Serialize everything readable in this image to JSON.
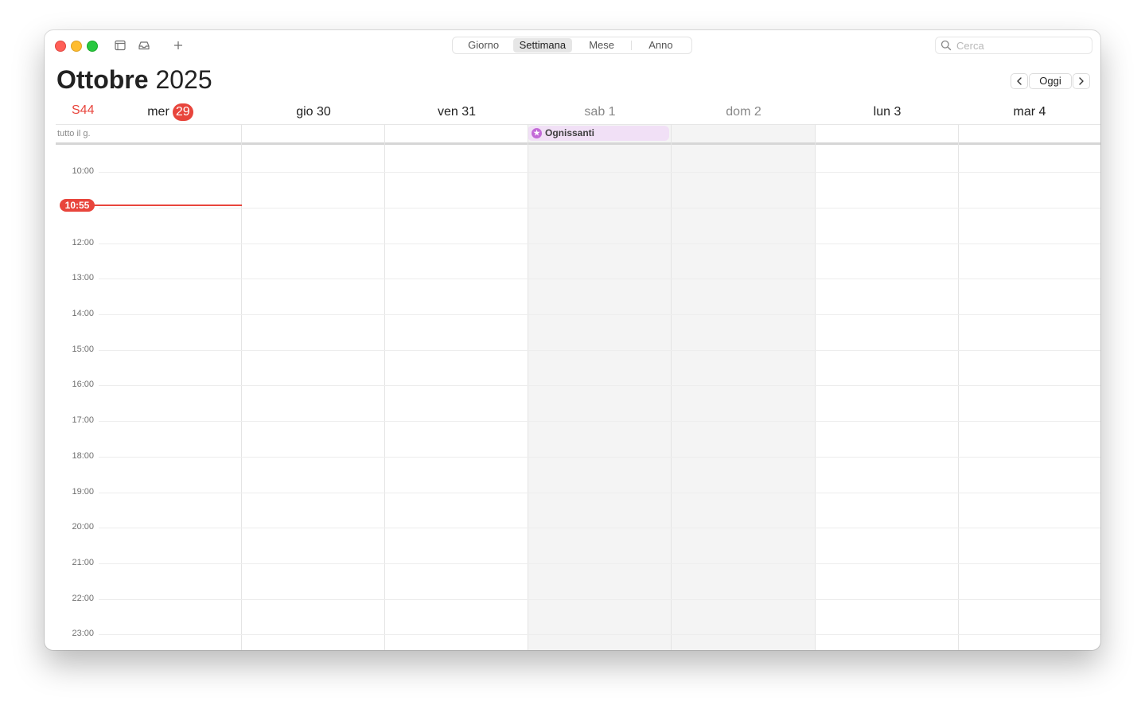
{
  "toolbar": {
    "views": [
      "Giorno",
      "Settimana",
      "Mese",
      "Anno"
    ],
    "active_view": "Settimana",
    "search_placeholder": "Cerca"
  },
  "header": {
    "month": "Ottobre",
    "year": "2025",
    "today_label": "Oggi"
  },
  "week": {
    "number": "S44",
    "days": [
      {
        "label": "mer",
        "date": "29",
        "today": true
      },
      {
        "label": "gio 30"
      },
      {
        "label": "ven 31"
      },
      {
        "label": "sab 1",
        "weekend": true
      },
      {
        "label": "dom 2",
        "weekend": true
      },
      {
        "label": "lun 3"
      },
      {
        "label": "mar 4"
      }
    ]
  },
  "all_day": {
    "label": "tutto il g.",
    "event": {
      "title": "Ognissanti",
      "color": "#c36ad8"
    }
  },
  "now": "10:55",
  "hours": [
    "10:00",
    "12:00",
    "13:00",
    "14:00",
    "15:00",
    "16:00",
    "17:00",
    "18:00",
    "19:00",
    "20:00",
    "21:00",
    "22:00",
    "23:00"
  ],
  "colors": {
    "accent_red": "#e8453c",
    "event_bg": "#f1e0f6"
  }
}
